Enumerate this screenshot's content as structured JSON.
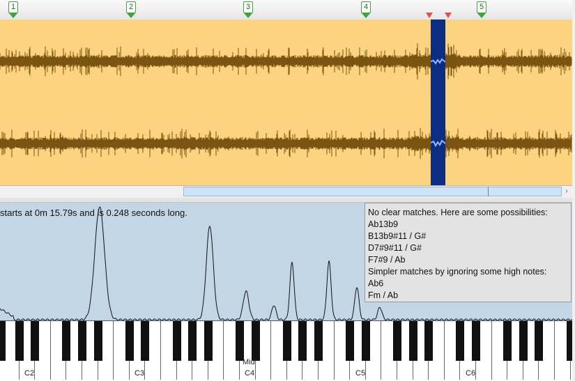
{
  "markers": [
    "1",
    "2",
    "3",
    "4",
    "5"
  ],
  "scrollbar": {
    "right_arrow": "›"
  },
  "spectrum": {
    "info_text": "starts at 0m 15.79s and is 0.248 seconds long."
  },
  "chord_panel": {
    "header": "No clear matches. Here are some possibilities:",
    "matches": [
      "Ab13b9",
      "B13b9#11 / G#",
      "D7#9#11 / G#",
      "F7#9 / Ab"
    ],
    "simpler_header": "Simpler matches by ignoring some high notes:",
    "simpler_matches": [
      "Ab6",
      "Fm / Ab"
    ]
  },
  "piano": {
    "octave_labels": [
      "C2",
      "C3",
      "C4",
      "C5",
      "C6"
    ],
    "middle_label": "Mid"
  },
  "colors": {
    "waveform_bg": "#fcd380",
    "waveform": "#7a5410",
    "selection": "#0b2e82",
    "spectrum_bg": "#c3d6e6",
    "marker": "#3aa53a"
  }
}
